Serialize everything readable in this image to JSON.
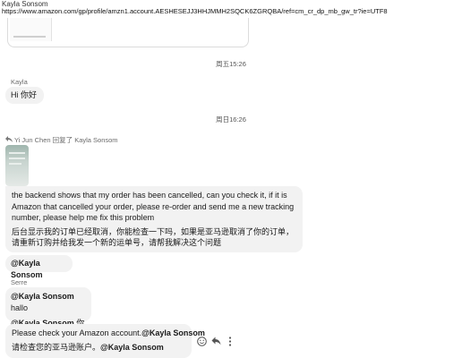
{
  "top_quote": {
    "sender": "Kayla Sonsom",
    "url": "https://www.amazon.com/gp/profile/amzn1.account.AESHESEJJ3HHJMMH2SQCK6ZGRQBA/ref=cm_cr_dp_mb_gw_tr?ie=UTF8"
  },
  "stamps": {
    "fri": "周五15:26",
    "sun": "周日16:26"
  },
  "msg_hi": {
    "sender": "Kayla",
    "text": "Hi  你好"
  },
  "reply_header": {
    "text": "Yi Jun Chen 回复了 Kayla Sonsom"
  },
  "reply_msg": {
    "en": "the backend shows that my order has been cancelled, can you check it, if it is Amazon that cancelled your order, please re-order and send me a new tracking number, please help me fix this problem",
    "zh": "后台显示我的订单已经取消，你能检查一下吗，如果是亚马逊取消了你的订单，请重新订购并给我发一个新的运单号，请帮我解决这个问题"
  },
  "mention_msg": {
    "mention": "@Kayla Sonsom"
  },
  "serre": {
    "sender": "Serre",
    "line1_mention": "@Kayla Sonsom",
    "line1_text": " hallo",
    "line2_mention": "@Kayla Sonsom",
    "line2_text": " 你好"
  },
  "last_msg": {
    "line1_text": "Please check your Amazon account.",
    "line1_mention": "@Kayla Sonsom",
    "line2_text": "请检查您的亚马逊账户。",
    "line2_mention": "@Kayla Sonsom"
  },
  "icons": {
    "reply_arrow": "reply-arrow-icon",
    "emoji": "emoji-icon",
    "reply": "reply-icon",
    "more": "more-icon"
  }
}
